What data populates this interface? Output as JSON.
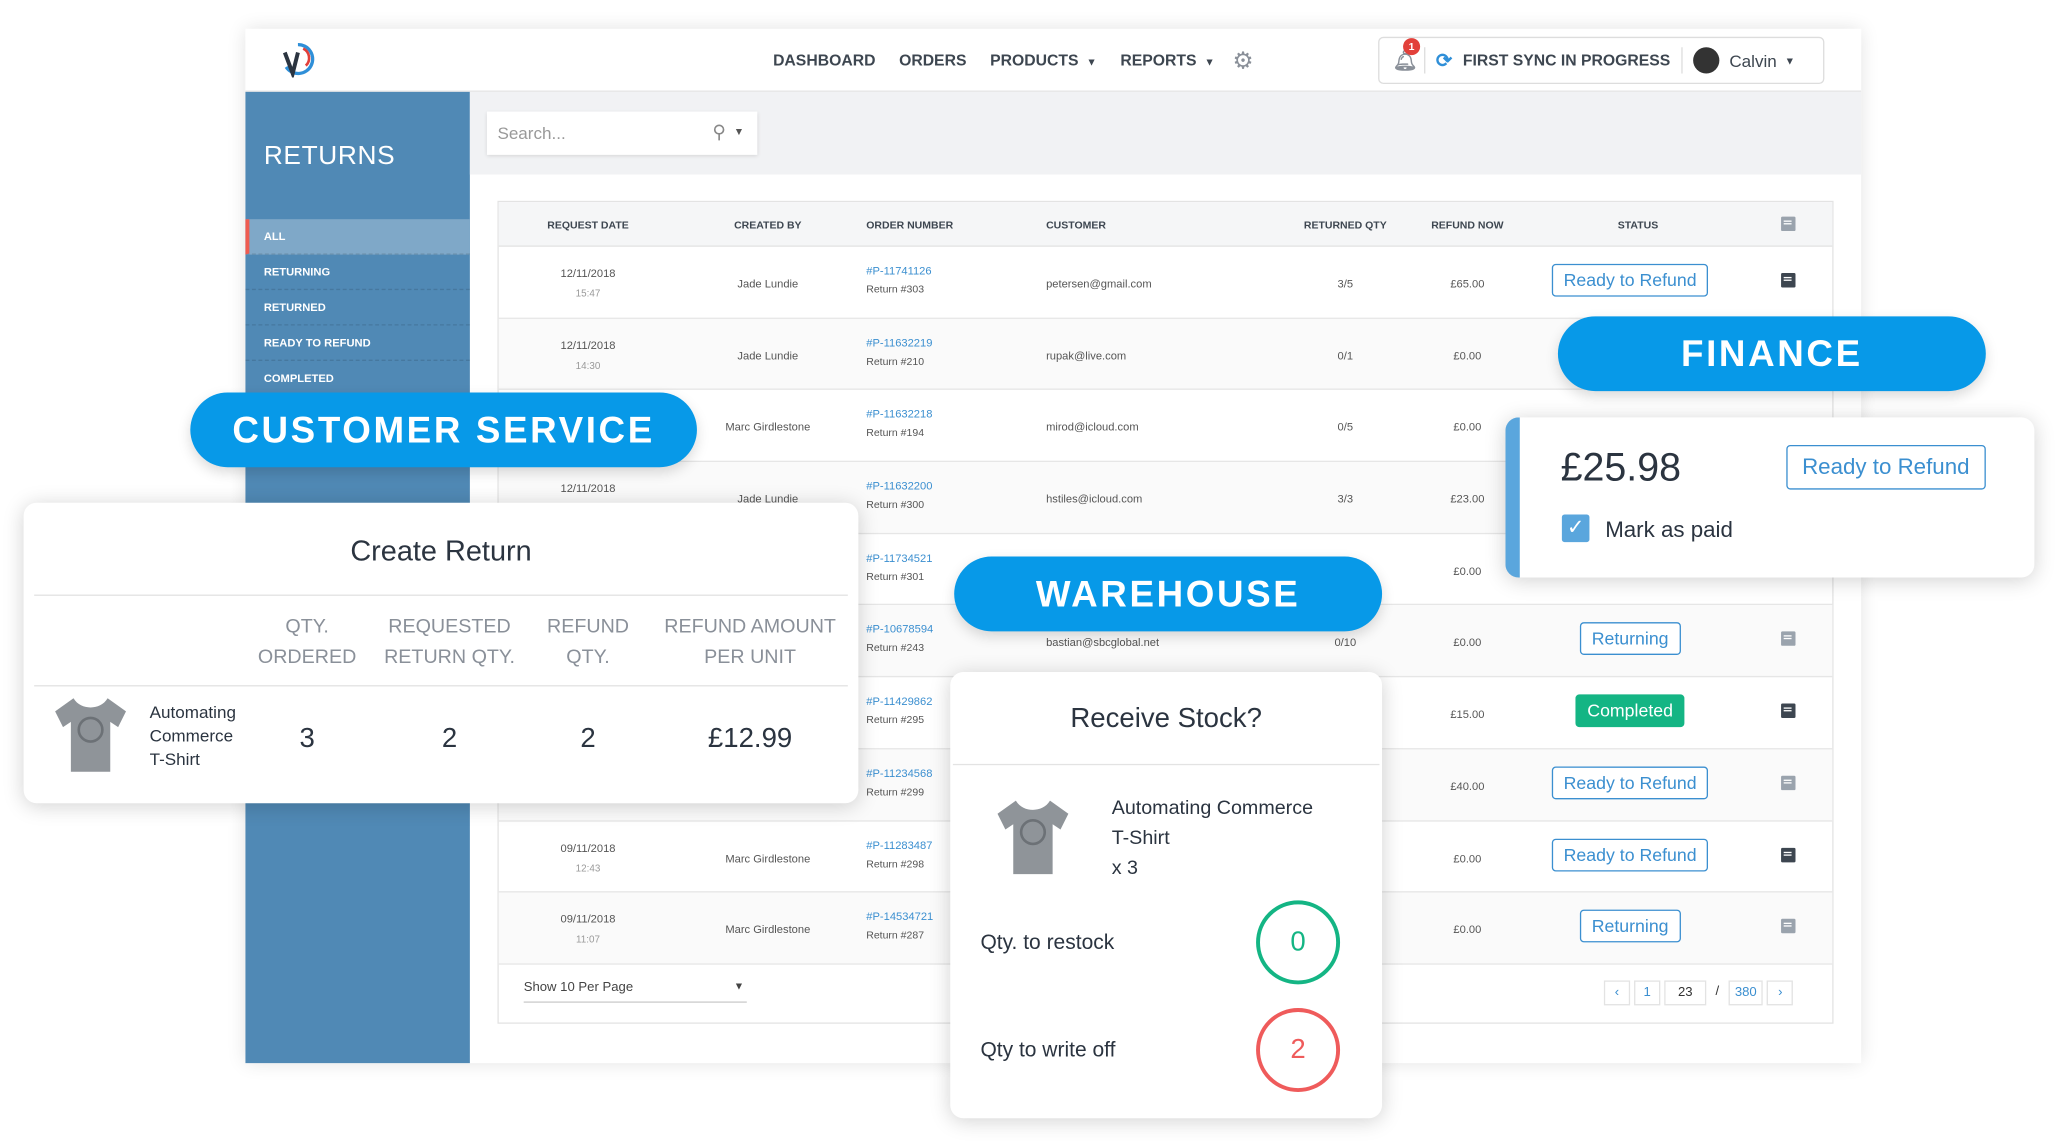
{
  "nav": {
    "items": [
      {
        "label": "DASHBOARD"
      },
      {
        "label": "ORDERS"
      },
      {
        "label": "PRODUCTS",
        "dropdown": true
      },
      {
        "label": "REPORTS",
        "dropdown": true
      }
    ],
    "settings_icon": "gear-icon"
  },
  "status": {
    "notifications": "1",
    "sync": "FIRST SYNC IN PROGRESS",
    "user": "Calvin"
  },
  "sidebar": {
    "title": "RETURNS",
    "items": [
      {
        "label": "ALL",
        "active": true
      },
      {
        "label": "RETURNING"
      },
      {
        "label": "RETURNED"
      },
      {
        "label": "READY TO REFUND"
      },
      {
        "label": "COMPLETED"
      }
    ]
  },
  "search": {
    "placeholder": "Search..."
  },
  "table": {
    "headers": [
      "REQUEST DATE",
      "CREATED BY",
      "ORDER NUMBER",
      "CUSTOMER",
      "RETURNED QTY",
      "REFUND NOW",
      "STATUS"
    ],
    "rows": [
      {
        "date": "12/11/2018",
        "time": "15:47",
        "by": "Jade Lundie",
        "order": "#P-11741126",
        "ret": "Return #303",
        "customer": "petersen@gmail.com",
        "qty": "3/5",
        "refund": "£65.00",
        "status": "Ready to Refund",
        "comment": "dark"
      },
      {
        "date": "12/11/2018",
        "time": "14:30",
        "by": "Jade Lundie",
        "order": "#P-11632219",
        "ret": "Return #210",
        "customer": "rupak@live.com",
        "qty": "0/1",
        "refund": "£0.00",
        "status": "",
        "comment": ""
      },
      {
        "date": "",
        "time": "",
        "by": "Marc Girdlestone",
        "order": "#P-11632218",
        "ret": "Return #194",
        "customer": "mirod@icloud.com",
        "qty": "0/5",
        "refund": "£0.00",
        "status": "",
        "comment": ""
      },
      {
        "date": "12/11/2018",
        "time": "",
        "by": "Jade Lundie",
        "order": "#P-11632200",
        "ret": "Return #300",
        "customer": "hstiles@icloud.com",
        "qty": "3/3",
        "refund": "£23.00",
        "status": "",
        "comment": ""
      },
      {
        "date": "",
        "time": "",
        "by": "",
        "order": "#P-11734521",
        "ret": "Return #301",
        "customer": "",
        "qty": "",
        "refund": "£0.00",
        "status": "",
        "comment": ""
      },
      {
        "date": "",
        "time": "",
        "by": "",
        "order": "#P-10678594",
        "ret": "Return #243",
        "customer": "bastian@sbcglobal.net",
        "qty": "0/10",
        "refund": "£0.00",
        "status": "Returning",
        "comment": "light"
      },
      {
        "date": "",
        "time": "",
        "by": "",
        "order": "#P-11429862",
        "ret": "Return #295",
        "customer": "",
        "qty": "",
        "refund": "£15.00",
        "status": "Completed",
        "comment": "dark"
      },
      {
        "date": "",
        "time": "",
        "by": "",
        "order": "#P-11234568",
        "ret": "Return #299",
        "customer": "",
        "qty": "",
        "refund": "£40.00",
        "status": "Ready to Refund",
        "comment": "light"
      },
      {
        "date": "09/11/2018",
        "time": "12:43",
        "by": "Marc Girdlestone",
        "order": "#P-11283487",
        "ret": "Return #298",
        "customer": "",
        "qty": "",
        "refund": "£0.00",
        "status": "Ready to Refund",
        "comment": "dark"
      },
      {
        "date": "09/11/2018",
        "time": "11:07",
        "by": "Marc Girdlestone",
        "order": "#P-14534721",
        "ret": "Return #287",
        "customer": "",
        "qty": "",
        "refund": "£0.00",
        "status": "Returning",
        "comment": "light"
      }
    ],
    "per_page": "Show 10 Per Page",
    "pager": {
      "first": "1",
      "current": "23",
      "sep": "/",
      "last": "380"
    }
  },
  "labels": {
    "customer_service": "CUSTOMER SERVICE",
    "finance": "FINANCE",
    "warehouse": "WAREHOUSE"
  },
  "create_return": {
    "title": "Create Return",
    "headers": [
      "QTY.\nORDERED",
      "REQUESTED\nRETURN QTY.",
      "REFUND\nQTY.",
      "REFUND AMOUNT\nPER UNIT"
    ],
    "product": "Automating\nCommerce\nT-Shirt",
    "qty_ordered": "3",
    "requested": "2",
    "refund_qty": "2",
    "amount": "£12.99"
  },
  "finance": {
    "amount": "£25.98",
    "status": "Ready to Refund",
    "mark_paid": "Mark as paid",
    "checked": true
  },
  "receive": {
    "title": "Receive Stock?",
    "product": "Automating Commerce\nT-Shirt\nx 3",
    "restock_label": "Qty. to restock",
    "restock": "0",
    "writeoff_label": "Qty to write off",
    "writeoff": "2"
  },
  "colors": {
    "accent": "#0799e8",
    "sidebar": "#5089b5",
    "completed": "#14b584",
    "link": "#3b8fd0"
  }
}
